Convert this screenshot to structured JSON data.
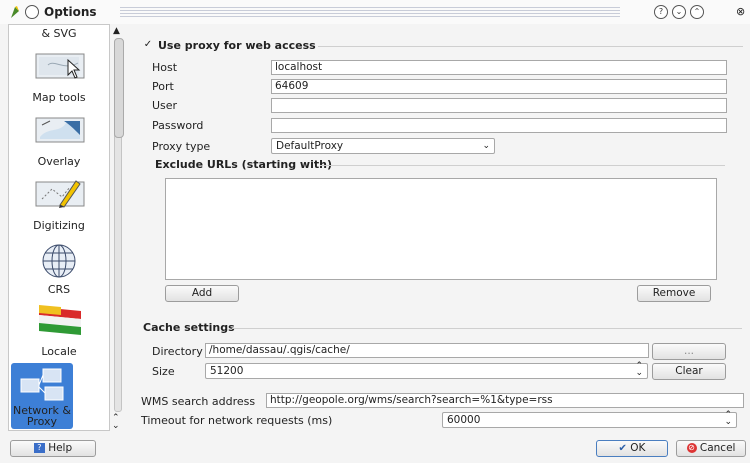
{
  "window": {
    "title": "Options"
  },
  "sidebar": {
    "items": [
      {
        "label": "& SVG",
        "icon": "svg-icon"
      },
      {
        "label": "Map tools",
        "icon": "map-tools-icon"
      },
      {
        "label": "Overlay",
        "icon": "overlay-icon"
      },
      {
        "label": "Digitizing",
        "icon": "digitizing-icon"
      },
      {
        "label": "CRS",
        "icon": "globe-icon"
      },
      {
        "label": "Locale",
        "icon": "flag-icon"
      },
      {
        "label": "Network & Proxy",
        "icon": "network-icon",
        "selected": true
      }
    ]
  },
  "proxy": {
    "use_proxy_label": "Use proxy for web access",
    "use_proxy_checked": true,
    "host_label": "Host",
    "host_value": "localhost",
    "port_label": "Port",
    "port_value": "64609",
    "user_label": "User",
    "user_value": "",
    "password_label": "Password",
    "password_value": "",
    "proxy_type_label": "Proxy type",
    "proxy_type_value": "DefaultProxy",
    "exclude_label": "Exclude URLs (starting with)",
    "add_label": "Add",
    "remove_label": "Remove"
  },
  "cache": {
    "section_label": "Cache settings",
    "directory_label": "Directory",
    "directory_value": "/home/dassau/.qgis/cache/",
    "browse_label": "...",
    "size_label": "Size",
    "size_value": "51200",
    "clear_label": "Clear"
  },
  "wms": {
    "label": "WMS search address",
    "value": "http://geopole.org/wms/search?search=%1&type=rss"
  },
  "timeout": {
    "label": "Timeout for network requests (ms)",
    "value": "60000"
  },
  "buttons": {
    "help_label": "Help",
    "ok_label": "OK",
    "cancel_label": "Cancel"
  }
}
